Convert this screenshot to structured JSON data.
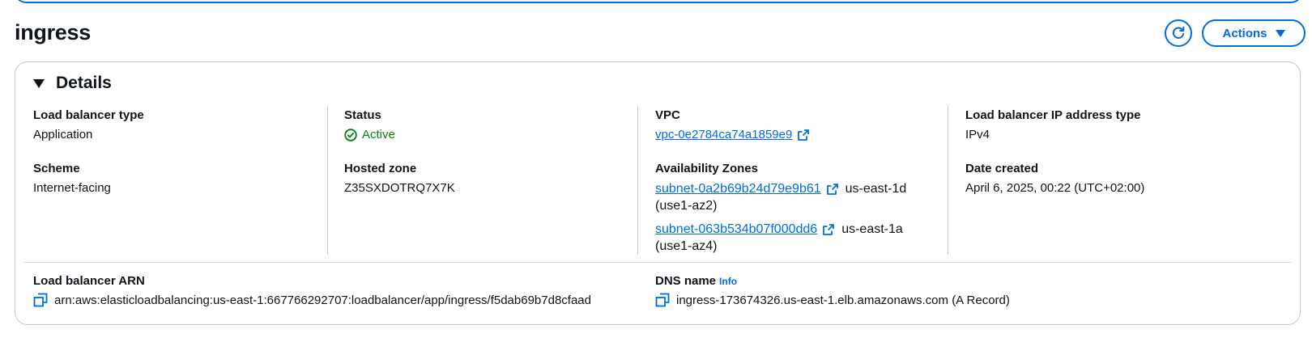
{
  "page": {
    "title": "ingress"
  },
  "header": {
    "actions_label": "Actions"
  },
  "details": {
    "heading": "Details",
    "load_balancer_type": {
      "label": "Load balancer type",
      "value": "Application"
    },
    "scheme": {
      "label": "Scheme",
      "value": "Internet-facing"
    },
    "status": {
      "label": "Status",
      "value": "Active"
    },
    "hosted_zone": {
      "label": "Hosted zone",
      "value": "Z35SXDOTRQ7X7K"
    },
    "vpc": {
      "label": "VPC",
      "value": "vpc-0e2784ca74a1859e9"
    },
    "availability_zones": {
      "label": "Availability Zones",
      "items": [
        {
          "subnet": "subnet-0a2b69b24d79e9b61",
          "zone": "us-east-1d",
          "az_id": "(use1-az2)"
        },
        {
          "subnet": "subnet-063b534b07f000dd6",
          "zone": "us-east-1a",
          "az_id": "(use1-az4)"
        }
      ]
    },
    "ip_address_type": {
      "label": "Load balancer IP address type",
      "value": "IPv4"
    },
    "date_created": {
      "label": "Date created",
      "value": "April 6, 2025, 00:22 (UTC+02:00)"
    },
    "arn": {
      "label": "Load balancer ARN",
      "value": "arn:aws:elasticloadbalancing:us-east-1:667766292707:loadbalancer/app/ingress/f5dab69b7d8cfaad"
    },
    "dns_name": {
      "label": "DNS name",
      "info": "Info",
      "value": "ingress-173674326.us-east-1.elb.amazonaws.com (A Record)"
    }
  },
  "colors": {
    "accent": "#006ce0",
    "success": "#037f0c",
    "text": "#0f141a",
    "divider": "#c6c6cd"
  },
  "icons": [
    "refresh-icon",
    "caret-down-icon",
    "expand-triangle-icon",
    "status-check-icon",
    "external-link-icon",
    "copy-icon"
  ]
}
